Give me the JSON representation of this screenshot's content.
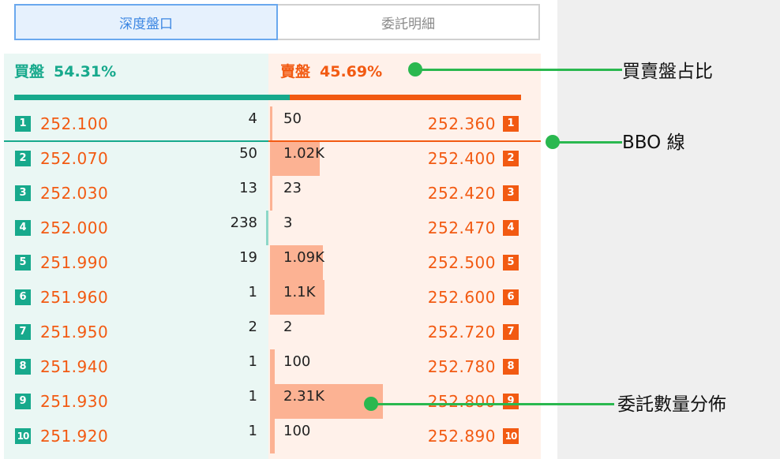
{
  "tabs": {
    "depth": "深度盤口",
    "orders": "委託明細"
  },
  "header": {
    "buy_label": "買盤",
    "buy_pct": "54.31%",
    "sell_label": "賣盤",
    "sell_pct": "45.69%",
    "buy_ratio": 54.31
  },
  "colors": {
    "buy": "#17a98c",
    "sell": "#f25a12",
    "annotation": "#2ab84f"
  },
  "rows": [
    {
      "level": "1",
      "bid_price": "252.100",
      "bid_qty": "4",
      "bid_fill": 0,
      "ask_qty": "50",
      "ask_price": "252.360",
      "ask_fill": 0.01
    },
    {
      "level": "2",
      "bid_price": "252.070",
      "bid_qty": "50",
      "bid_fill": 0.01,
      "ask_qty": "1.02K",
      "ask_price": "252.400",
      "ask_fill": 0.44
    },
    {
      "level": "3",
      "bid_price": "252.030",
      "bid_qty": "13",
      "bid_fill": 0,
      "ask_qty": "23",
      "ask_price": "252.420",
      "ask_fill": 0.01
    },
    {
      "level": "4",
      "bid_price": "252.000",
      "bid_qty": "238",
      "bid_fill": 0.1,
      "ask_qty": "3",
      "ask_price": "252.470",
      "ask_fill": 0
    },
    {
      "level": "5",
      "bid_price": "251.990",
      "bid_qty": "19",
      "bid_fill": 0,
      "ask_qty": "1.09K",
      "ask_price": "252.500",
      "ask_fill": 0.47
    },
    {
      "level": "6",
      "bid_price": "251.960",
      "bid_qty": "1",
      "bid_fill": 0,
      "ask_qty": "1.1K",
      "ask_price": "252.600",
      "ask_fill": 0.48
    },
    {
      "level": "7",
      "bid_price": "251.950",
      "bid_qty": "2",
      "bid_fill": 0,
      "ask_qty": "2",
      "ask_price": "252.720",
      "ask_fill": 0
    },
    {
      "level": "8",
      "bid_price": "251.940",
      "bid_qty": "1",
      "bid_fill": 0,
      "ask_qty": "100",
      "ask_price": "252.780",
      "ask_fill": 0.04
    },
    {
      "level": "9",
      "bid_price": "251.930",
      "bid_qty": "1",
      "bid_fill": 0,
      "ask_qty": "2.31K",
      "ask_price": "252.800",
      "ask_fill": 1.0
    },
    {
      "level": "10",
      "bid_price": "251.920",
      "bid_qty": "1",
      "bid_fill": 0,
      "ask_qty": "100",
      "ask_price": "252.890",
      "ask_fill": 0.04
    }
  ],
  "annotations": {
    "ratio": "買賣盤占比",
    "bbo": "BBO 線",
    "distribution": "委託數量分佈"
  }
}
